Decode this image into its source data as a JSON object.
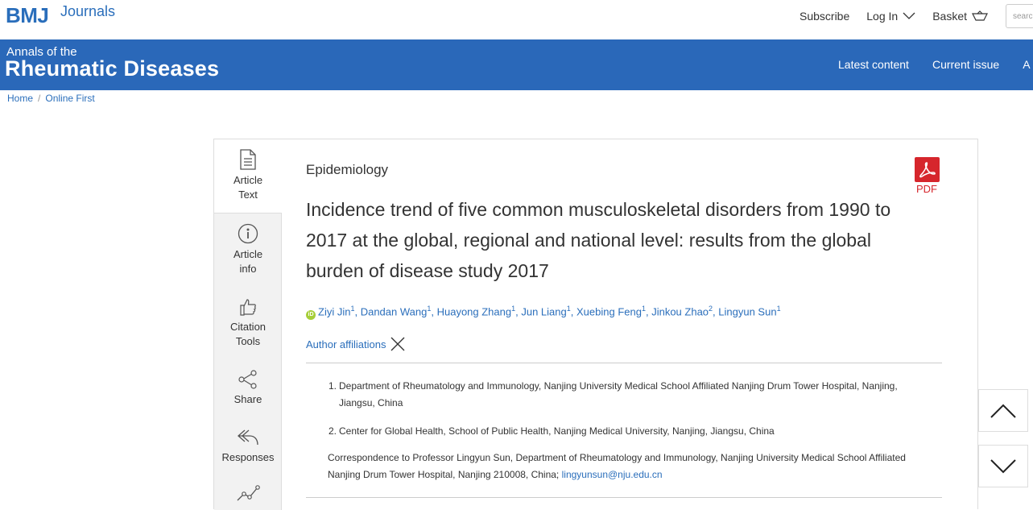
{
  "header": {
    "logo": "BMJ",
    "logo_suffix": "Journals",
    "links": {
      "subscribe": "Subscribe",
      "login": "Log In",
      "basket": "Basket"
    },
    "search_placeholder": "search"
  },
  "banner": {
    "journal_line1": "Annals of the",
    "journal_line2": "Rheumatic Diseases",
    "nav": [
      "Latest content",
      "Current issue",
      "A"
    ]
  },
  "breadcrumb": {
    "home": "Home",
    "current": "Online First"
  },
  "sidebar": {
    "items": [
      {
        "label1": "Article",
        "label2": "Text",
        "icon": "document-icon"
      },
      {
        "label1": "Article",
        "label2": "info",
        "icon": "info-icon"
      },
      {
        "label1": "Citation",
        "label2": "Tools",
        "icon": "thumbs-up-icon"
      },
      {
        "label1": "Share",
        "label2": "",
        "icon": "share-icon"
      },
      {
        "label1": "Responses",
        "label2": "",
        "icon": "reply-icon"
      }
    ]
  },
  "article": {
    "category": "Epidemiology",
    "title": "Incidence trend of five common musculoskeletal disorders from 1990 to 2017 at the global, regional and national level: results from the global burden of disease study 2017",
    "pdf_label": "PDF",
    "authors": [
      {
        "name": "Ziyi Jin",
        "aff": "1"
      },
      {
        "name": "Dandan Wang",
        "aff": "1"
      },
      {
        "name": "Huayong Zhang",
        "aff": "1"
      },
      {
        "name": "Jun Liang",
        "aff": "1"
      },
      {
        "name": "Xuebing Feng",
        "aff": "1"
      },
      {
        "name": "Jinkou Zhao",
        "aff": "2"
      },
      {
        "name": "Lingyun Sun",
        "aff": "1"
      }
    ],
    "affiliations_toggle": "Author affiliations",
    "affiliations": [
      {
        "num": "1.",
        "text": "Department of Rheumatology and Immunology, Nanjing University Medical School Affiliated Nanjing Drum Tower Hospital, Nanjing, Jiangsu, China"
      },
      {
        "num": "2.",
        "text": "Center for Global Health, School of Public Health, Nanjing Medical University, Nanjing, Jiangsu, China"
      }
    ],
    "correspondence": "Correspondence to Professor Lingyun Sun, Department of Rheumatology and Immunology, Nanjing University Medical School Affiliated Nanjing Drum Tower Hospital, Nanjing 210008, China;",
    "email": "lingyunsun@nju.edu.cn"
  },
  "colors": {
    "brand_blue": "#2a68b9",
    "link_blue": "#2a6ebb",
    "pdf_red": "#d6262c",
    "orcid_green": "#a6ce39"
  }
}
